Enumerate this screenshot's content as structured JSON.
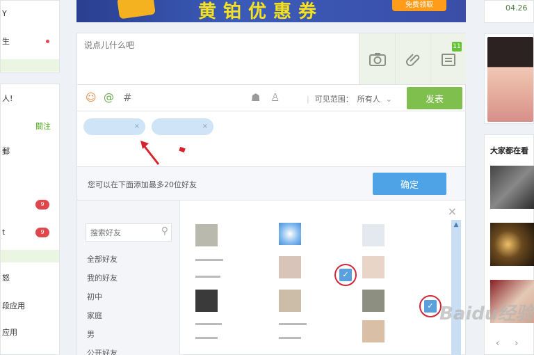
{
  "left_nav": {
    "upper_items": [
      {
        "label": "Y",
        "dot": false
      },
      {
        "label": "生",
        "dot": true
      },
      {
        "label": "",
        "dot": false
      }
    ],
    "lower_items": [
      {
        "label": "人!",
        "badge": ""
      },
      {
        "label": "",
        "badge": "",
        "follow": "關注"
      },
      {
        "label": "郵",
        "badge": ""
      },
      {
        "label": "",
        "badge": ""
      },
      {
        "label": "",
        "badge": "9"
      },
      {
        "label": "t",
        "badge": "9"
      },
      {
        "label": "",
        "badge": ""
      },
      {
        "label": "怒",
        "badge": ""
      },
      {
        "label": "段应用",
        "badge": ""
      },
      {
        "label": "应用",
        "badge": ""
      }
    ]
  },
  "banner": {
    "title": "黄铂优惠券",
    "badge": "免费领取"
  },
  "composer": {
    "placeholder": "说点儿什么吧",
    "tools": [
      "camera-icon",
      "attachment-icon",
      "grid-icon"
    ],
    "tool_badge": "11"
  },
  "toolbar": {
    "icons": [
      "emoji-icon",
      "at-icon",
      "hash-icon",
      "ghost-icon"
    ],
    "visibility_label": "可见范围：",
    "visibility_value": "所有人",
    "publish_label": "发表"
  },
  "tags": [
    {
      "label": "",
      "x": "×"
    },
    {
      "label": "",
      "x": "×"
    }
  ],
  "info": {
    "hint": "您可以在下面添加最多20位好友",
    "confirm_label": "确定"
  },
  "picker": {
    "search_placeholder": "搜索好友",
    "groups": [
      "全部好友",
      "我的好友",
      "初中",
      "家庭",
      "男",
      "公开好友"
    ],
    "close": "×",
    "friends_selected": [
      false,
      false,
      false,
      false,
      true,
      false,
      false,
      false,
      true,
      false,
      false,
      false
    ]
  },
  "right": {
    "date": "04.26",
    "watching_title": "大家都在看",
    "pager_prev": "‹",
    "pager_next": "›"
  },
  "watermark": "Baidu经验"
}
